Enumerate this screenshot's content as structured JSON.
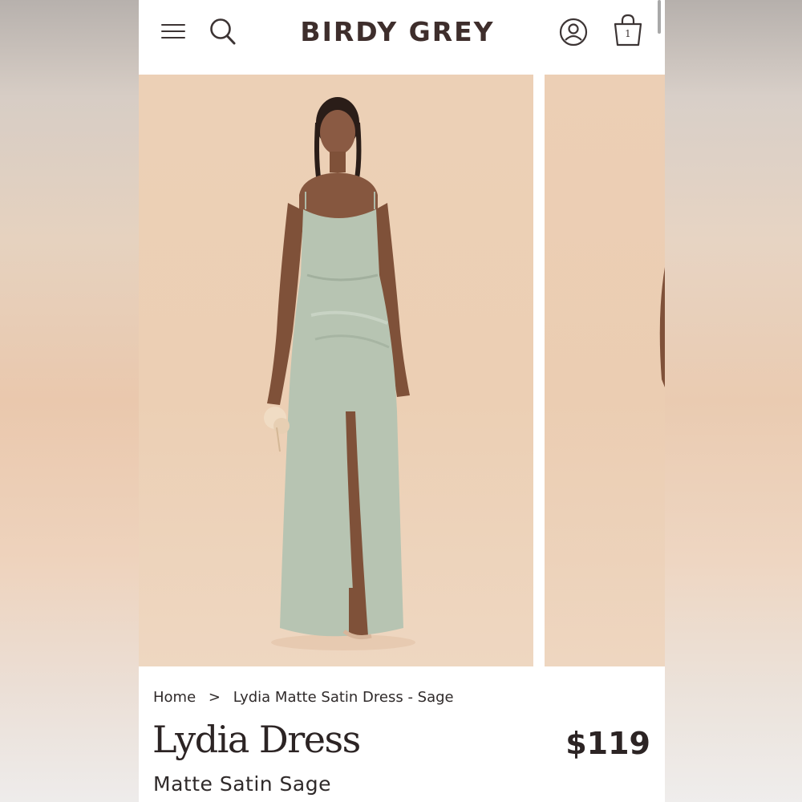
{
  "header": {
    "brand": "BIRDY GREY",
    "cart_count": "1",
    "icons": [
      "menu-icon",
      "search-icon",
      "account-icon",
      "shopping-bag-icon"
    ]
  },
  "gallery": {
    "images": [
      {
        "name": "product-photo-1",
        "description": "model in sage satin gown"
      },
      {
        "name": "product-photo-2",
        "description": "partial next image"
      }
    ],
    "colors": {
      "backdrop": "#ecd0b6",
      "dress": "#b9c6b4"
    }
  },
  "breadcrumb": {
    "home": "Home",
    "separator": ">",
    "current": "Lydia Matte Satin Dress - Sage"
  },
  "product": {
    "title": "Lydia Dress",
    "price": "$119",
    "subtitle": "Matte Satin Sage"
  },
  "colors": {
    "text": "#2c2424",
    "brand": "#3e2e2c"
  }
}
